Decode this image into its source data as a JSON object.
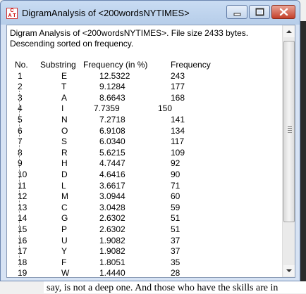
{
  "window": {
    "title": "DigramAnalysis of <200wordsNYTIMES>"
  },
  "header": {
    "line1": "Digram Analysis of <200wordsNYTIMES>. File size 2433 bytes.",
    "line2": "Descending sorted on frequency."
  },
  "columns": {
    "no": "No.",
    "substring": "Substring",
    "pct": "Frequency (in %)",
    "count": "Frequency"
  },
  "rows": [
    {
      "no": "1",
      "sub": "E",
      "pct": "12.5322",
      "cnt": "243"
    },
    {
      "no": "2",
      "sub": "T",
      "pct": "9.1284",
      "cnt": "177"
    },
    {
      "no": "3",
      "sub": "A",
      "pct": "8.6643",
      "cnt": "168"
    },
    {
      "no": "4",
      "sub": "I",
      "pct": "7.7359",
      "cnt": "150"
    },
    {
      "no": "5",
      "sub": "N",
      "pct": "7.2718",
      "cnt": "141"
    },
    {
      "no": "6",
      "sub": "O",
      "pct": "6.9108",
      "cnt": "134"
    },
    {
      "no": "7",
      "sub": "S",
      "pct": "6.0340",
      "cnt": "117"
    },
    {
      "no": "8",
      "sub": "R",
      "pct": "5.6215",
      "cnt": "109"
    },
    {
      "no": "9",
      "sub": "H",
      "pct": "4.7447",
      "cnt": "92"
    },
    {
      "no": "10",
      "sub": "D",
      "pct": "4.6416",
      "cnt": "90"
    },
    {
      "no": "11",
      "sub": "L",
      "pct": "3.6617",
      "cnt": "71"
    },
    {
      "no": "12",
      "sub": "M",
      "pct": "3.0944",
      "cnt": "60"
    },
    {
      "no": "13",
      "sub": "C",
      "pct": "3.0428",
      "cnt": "59"
    },
    {
      "no": "14",
      "sub": "G",
      "pct": "2.6302",
      "cnt": "51"
    },
    {
      "no": "15",
      "sub": "P",
      "pct": "2.6302",
      "cnt": "51"
    },
    {
      "no": "16",
      "sub": "U",
      "pct": "1.9082",
      "cnt": "37"
    },
    {
      "no": "17",
      "sub": "Y",
      "pct": "1.9082",
      "cnt": "37"
    },
    {
      "no": "18",
      "sub": "F",
      "pct": "1.8051",
      "cnt": "35"
    },
    {
      "no": "19",
      "sub": "W",
      "pct": "1.4440",
      "cnt": "28"
    }
  ],
  "background_text": "say, is not a deep one. And those who have the skills are in",
  "icons": {
    "app": "cat-app-icon",
    "minimize": "minimize-icon",
    "maximize": "maximize-icon",
    "close": "close-icon"
  }
}
